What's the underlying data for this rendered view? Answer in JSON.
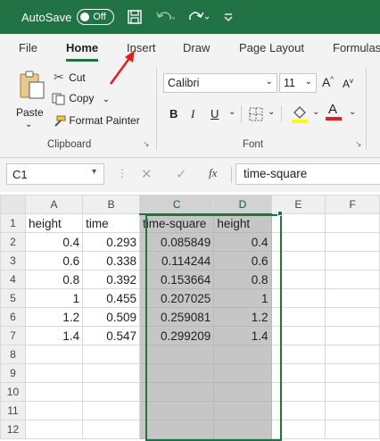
{
  "titlebar": {
    "autosave_label": "AutoSave",
    "autosave_state": "Off"
  },
  "tabs": [
    "File",
    "Home",
    "Insert",
    "Draw",
    "Page Layout",
    "Formulas"
  ],
  "active_tab": "Home",
  "clipboard": {
    "paste": "Paste",
    "cut": "Cut",
    "copy": "Copy",
    "format_painter": "Format Painter",
    "group": "Clipboard"
  },
  "font": {
    "name": "Calibri",
    "size": "11",
    "group": "Font",
    "bold": "B",
    "italic": "I",
    "underline": "U",
    "grow": "A",
    "shrink": "A",
    "font_color": "A"
  },
  "formula_bar": {
    "name_box": "C1",
    "fx": "fx",
    "content": "time-square"
  },
  "grid": {
    "columns": [
      "A",
      "B",
      "C",
      "D",
      "E",
      "F"
    ],
    "rows": [
      [
        "height",
        "time",
        "time-square",
        "height",
        "",
        ""
      ],
      [
        "0.4",
        "0.293",
        "0.085849",
        "0.4",
        "",
        ""
      ],
      [
        "0.6",
        "0.338",
        "0.114244",
        "0.6",
        "",
        ""
      ],
      [
        "0.8",
        "0.392",
        "0.153664",
        "0.8",
        "",
        ""
      ],
      [
        "1",
        "0.455",
        "0.207025",
        "1",
        "",
        ""
      ],
      [
        "1.2",
        "0.509",
        "0.259081",
        "1.2",
        "",
        ""
      ],
      [
        "1.4",
        "0.547",
        "0.299209",
        "1.4",
        "",
        ""
      ],
      [
        "",
        "",
        "",
        "",
        "",
        ""
      ],
      [
        "",
        "",
        "",
        "",
        "",
        ""
      ],
      [
        "",
        "",
        "",
        "",
        "",
        ""
      ],
      [
        "",
        "",
        "",
        "",
        "",
        ""
      ],
      [
        "",
        "",
        "",
        "",
        "",
        ""
      ]
    ]
  },
  "colors": {
    "accent": "#217346",
    "arrow": "#e02020",
    "highlight": "#ffff00",
    "font_color": "#e02020"
  }
}
